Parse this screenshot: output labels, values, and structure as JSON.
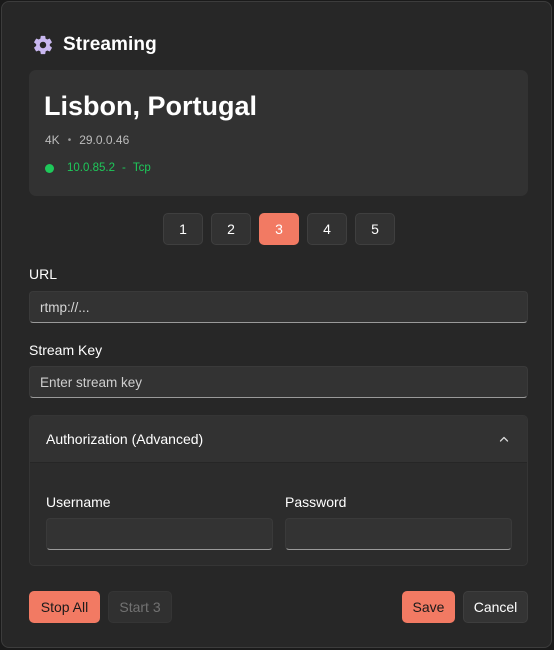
{
  "window": {
    "title": "Streaming",
    "title_icon": "gear-icon"
  },
  "card": {
    "location": "Lisbon, Portugal",
    "resolution": "4K",
    "separator": "•",
    "version": "29.0.0.46",
    "status_color": "#1ec85a",
    "ip": "10.0.85.2",
    "conn_separator": "-",
    "protocol": "Tcp"
  },
  "pager": {
    "pages": [
      "1",
      "2",
      "3",
      "4",
      "5"
    ],
    "selected": "3"
  },
  "form": {
    "url_label": "URL",
    "url_value": "rtmp://...",
    "key_label": "Stream Key",
    "key_placeholder": "Enter stream key"
  },
  "auth": {
    "header": "Authorization (Advanced)",
    "expanded": true,
    "username_label": "Username",
    "username_value": "",
    "password_label": "Password",
    "password_value": ""
  },
  "footer": {
    "stop_all": "Stop All",
    "start": "Start 3",
    "save": "Save",
    "cancel": "Cancel"
  },
  "colors": {
    "accent": "#f27a63",
    "status_ok": "#1ec85a",
    "background": "#272727",
    "card": "#323232"
  }
}
